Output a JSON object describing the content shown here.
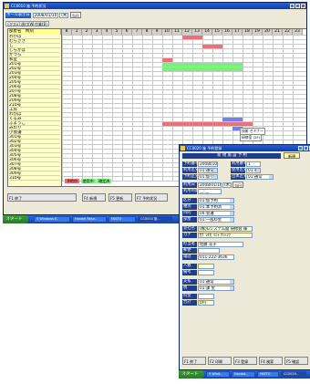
{
  "colors": {
    "reserved_pink": "#ef6e78",
    "confirmed_green": "#7bef7b",
    "blue_bar": "#7080f0",
    "name_yellow": "#ffffcc"
  },
  "back_window": {
    "title": "CC0010 施 予約状況",
    "date_label": "ホール表示日",
    "date_value": "2008/01/10",
    "weekday": "(木)",
    "today_button": "当日",
    "tabs": [
      "日付(U)",
      "週付(W)",
      "作業(B)"
    ],
    "name_header": "部屋名",
    "name_header2": "時刻",
    "hours": [
      "8",
      "1",
      "2",
      "3",
      "4",
      "5",
      "6",
      "7",
      "8",
      "9",
      "10",
      "11",
      "12",
      "13",
      "14",
      "15",
      "16",
      "17",
      "18",
      "19",
      "20",
      "21",
      "22",
      "23"
    ],
    "rows": [
      "わかば",
      "むらさき",
      "し",
      "しらかば",
      "かつら",
      "和室",
      "201号",
      "202号",
      "203号",
      "204号",
      "205号",
      "206号",
      "207号",
      "208号",
      "209号",
      "210号",
      "工房",
      "わかば",
      "くるみ",
      "ふようこ",
      "みのり",
      "小会議",
      "301号",
      "302号",
      "303号",
      "304号",
      "305号",
      "306号",
      "307号",
      "308号",
      "309号",
      "310号"
    ],
    "legend": [
      "予約中",
      "使用中",
      "確定済"
    ],
    "event_label": "技術 セミナー",
    "event_label2": "研修室 (2F)",
    "fkeys": [
      "F1 終了",
      "F4 新規",
      "F5 更新",
      "F7 予約状況"
    ]
  },
  "front_window": {
    "title": "CC0020 施 予約登録",
    "header_label": "新 規 施 設 予 約",
    "new_button": "新規",
    "fields": {
      "reserve_no_label": "予約番号",
      "reserve_no": "2008010",
      "seq_label": "利用番号",
      "seq_value": "1",
      "type_label": "利用区分",
      "type_value": "01:通常",
      "status_label": "使用区分",
      "status_value": "01:有料",
      "kind_label": "予約区分",
      "kind_value": "01:仮り",
      "group_label": "団体区分",
      "group_value": "01:通常",
      "date_label": "利用日",
      "date_value": "2008/01/10",
      "date_weekday": "(木)",
      "today": "当日",
      "time_label": "利用時間",
      "time_value": "__:__",
      "f1_label": "区分",
      "f1_value": "01:仮予約",
      "f2_label": "種別",
      "f2_value": "01:本予約済",
      "f3_label": "目的",
      "f3_value": "04:会議",
      "f4_label": "部屋",
      "f4_value": "01:一般料金",
      "company_label": "会社名",
      "company_value": "(株)Gシステム開 研修会 様",
      "kana_label": "カナ",
      "kana_value": "ｶﾌﾞｼｷｶﾞｲｼｬ ｹﾝｼｭｳ",
      "contact_label": "担当者",
      "contact_value": "佐藤 花子",
      "zip_label": "郵便",
      "zip_value": "",
      "tel_label": "電話",
      "tel_value": "011-222-3636",
      "people_label": "人数",
      "people_value": "",
      "memo_label": "備考",
      "memo_value": "",
      "pay_label": "支払",
      "pay_value": "01:通常",
      "tax_label": "税",
      "tax_value": "01:課 金",
      "fee_label": "料金",
      "fee_value": "",
      "total_label": "合計",
      "total_value": "0円"
    },
    "fkeys": [
      "F1 終了",
      "F2 印刷",
      "F3 登録",
      "F4 検索",
      "F5 確認"
    ]
  },
  "taskbar_back": {
    "start": "スタート",
    "items": [
      "5 Windows E..",
      "Handel Rese..",
      "FKSTO",
      "CC0010 施..."
    ],
    "clock": "9:32"
  },
  "taskbar_front": {
    "start": "スタート",
    "items": [
      "5 Wind..",
      "Handel..",
      "FKSTO",
      "CC0020.."
    ],
    "clock": "9:34"
  }
}
